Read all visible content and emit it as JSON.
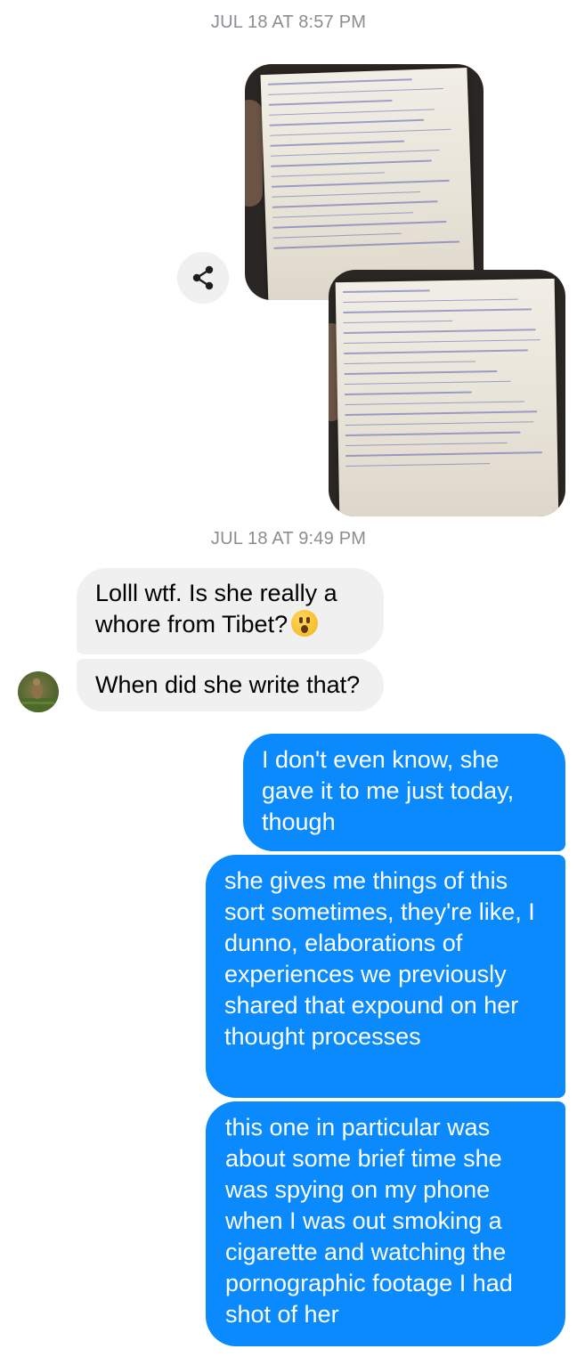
{
  "thread": {
    "timestamp_1": "JUL 18 AT 8:57 PM",
    "timestamp_2": "JUL 18 AT 9:49 PM"
  },
  "attachments": [
    {
      "kind": "photo",
      "icon": "handwritten-note-photo"
    },
    {
      "kind": "photo",
      "icon": "handwritten-note-photo"
    }
  ],
  "share_button": {
    "icon": "share-icon"
  },
  "messages": {
    "incoming_1": "Lolll wtf. Is she really a whore from Tibet?",
    "incoming_1_emoji": "open-mouth-emoji",
    "incoming_2": "When did she write that?",
    "outgoing_1": "I don't even know, she gave it to me just today, though",
    "outgoing_2": "she gives me things of this sort sometimes, they're like, I dunno, elaborations of experiences we previously shared that expound on her thought processes",
    "outgoing_3": "this one in particular was about some brief time she was spying on my phone when I was out smoking a cigarette and watching the pornographic footage I had shot of her"
  },
  "colors": {
    "outgoing_bubble": "#0a8afc",
    "incoming_bubble": "#f0f0f0",
    "timestamp": "#8a8d91"
  }
}
